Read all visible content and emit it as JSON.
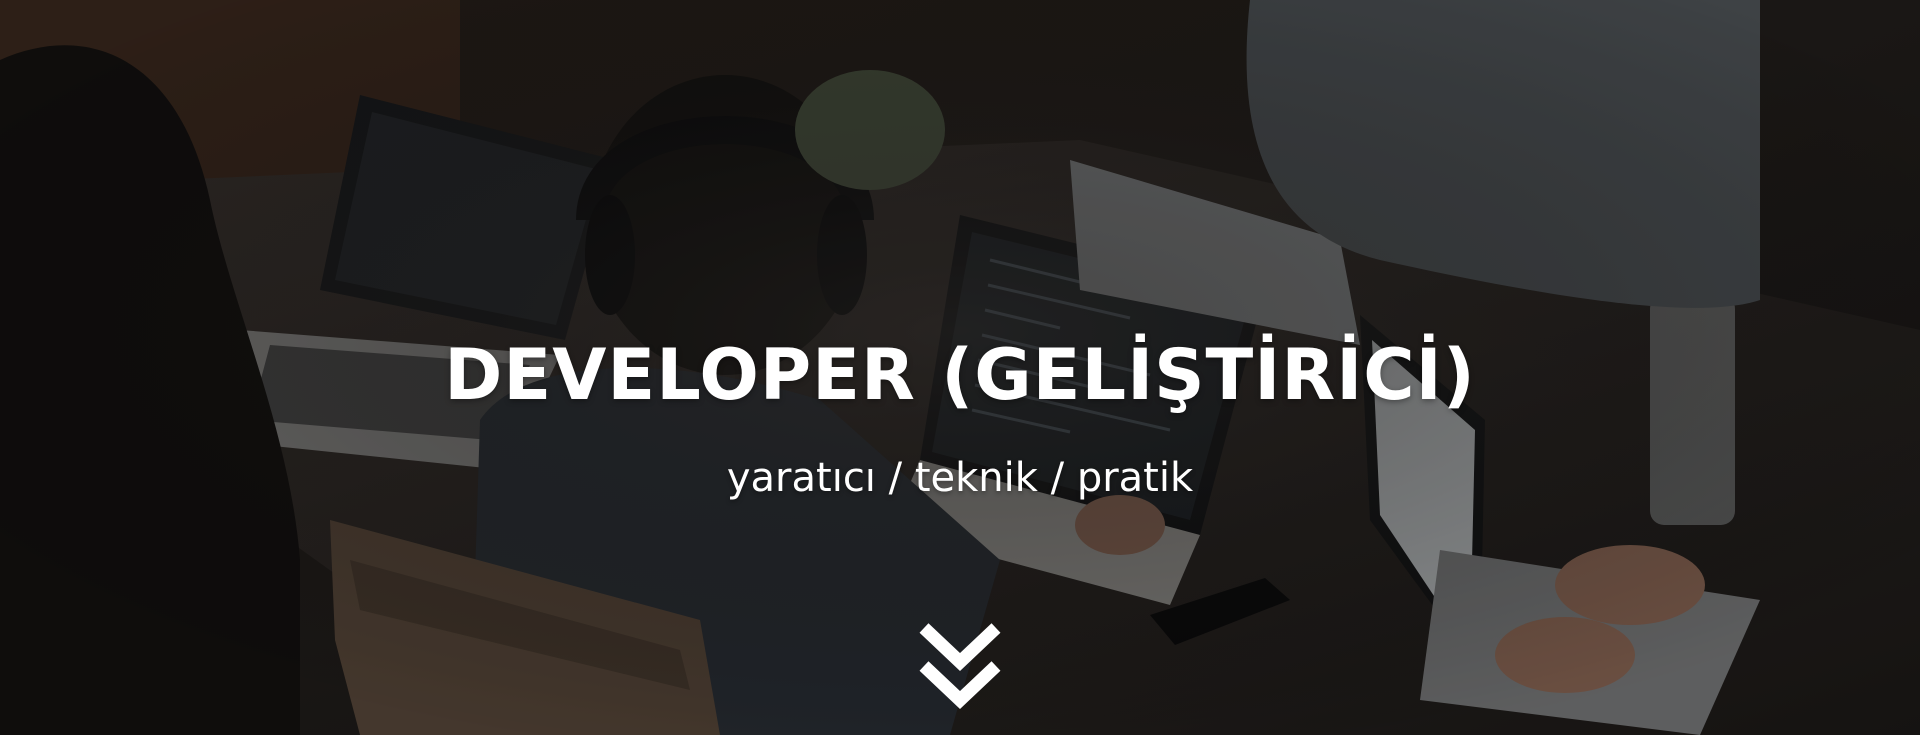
{
  "hero": {
    "title": "DEVELOPER (GELİŞTİRİCİ)",
    "subtitle": "yaratıcı / teknik / pratik",
    "scroll_icon": "double-chevron-down-icon",
    "background_image": "team-working-on-laptops-photo"
  },
  "colors": {
    "text": "#ffffff",
    "overlay": "rgba(0,0,0,0.25)"
  }
}
